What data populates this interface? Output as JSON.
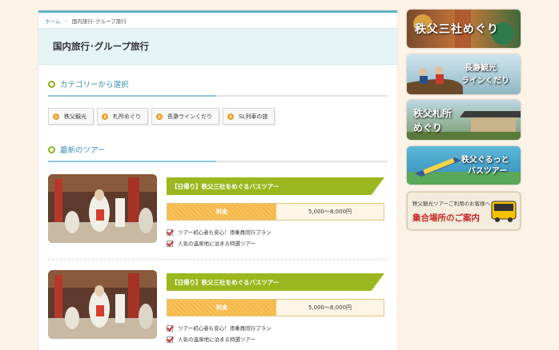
{
  "breadcrumb": {
    "home": "ホーム",
    "current": "国内旅行･グループ旅行"
  },
  "page_title": "国内旅行･グループ旅行",
  "category_section": {
    "heading": "カテゴリーから選択",
    "items": [
      "秩父観光",
      "札所めぐり",
      "長瀞ラインくだり",
      "SL列車の旅"
    ]
  },
  "tour_section": {
    "heading": "最新のツアー"
  },
  "tours": [
    {
      "title": "【日帰り】秩父三社をめぐるバスツアー",
      "price_label": "料金",
      "price_value": "5,000～8,000円",
      "notes": [
        "ツアー初心者も安心！添乗員同行プラン",
        "人気の温泉地に泊まる特選ツアー"
      ]
    },
    {
      "title": "【日帰り】秩父三社をめぐるバスツアー",
      "price_label": "料金",
      "price_value": "5,000～8,000円",
      "notes": [
        "ツアー初心者も安心！添乗員同行プラン",
        "人気の温泉地に泊まる特選ツアー"
      ]
    }
  ],
  "banners": [
    {
      "text": "秩父三社めぐり"
    },
    {
      "line1": "長瀞観光",
      "line2": "ラインくだり"
    },
    {
      "line1": "秩父札所",
      "line2": "めぐり"
    },
    {
      "line1": "秩父ぐるっと",
      "line2": "バスツアー"
    },
    {
      "line1": "秩父観光ツアーご利用のお客様へ",
      "line2": "集合場所のご案内"
    }
  ],
  "colors": {
    "accent": "#5fb3c8",
    "ribbon": "#9ab81e",
    "price": "#f7c35d",
    "link": "#3a8fb0"
  }
}
